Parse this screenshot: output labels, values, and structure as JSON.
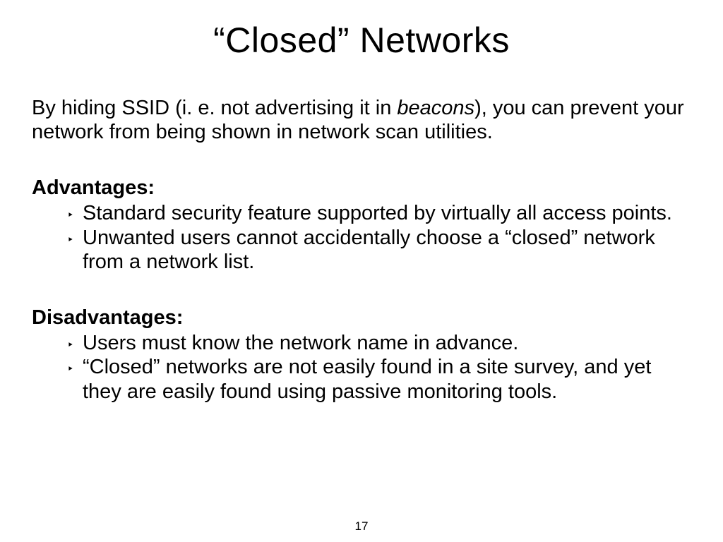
{
  "title": "“Closed” Networks",
  "intro_pre": "By hiding SSID (i. e. not advertising it in ",
  "intro_em": "beacons",
  "intro_post": "), you can prevent your network from being shown in network scan utilities.",
  "advantages": {
    "heading": "Advantages",
    "items": [
      "Standard security feature supported by virtually all access points.",
      "Unwanted users cannot accidentally choose a “closed” network from a network list."
    ]
  },
  "disadvantages": {
    "heading": "Disadvantages",
    "items": [
      "Users must know the network name in advance.",
      "“Closed” networks are not easily found in a site survey, and yet they are easily found using passive monitoring tools."
    ]
  },
  "bullet_marker": "‣",
  "page_number": "17"
}
